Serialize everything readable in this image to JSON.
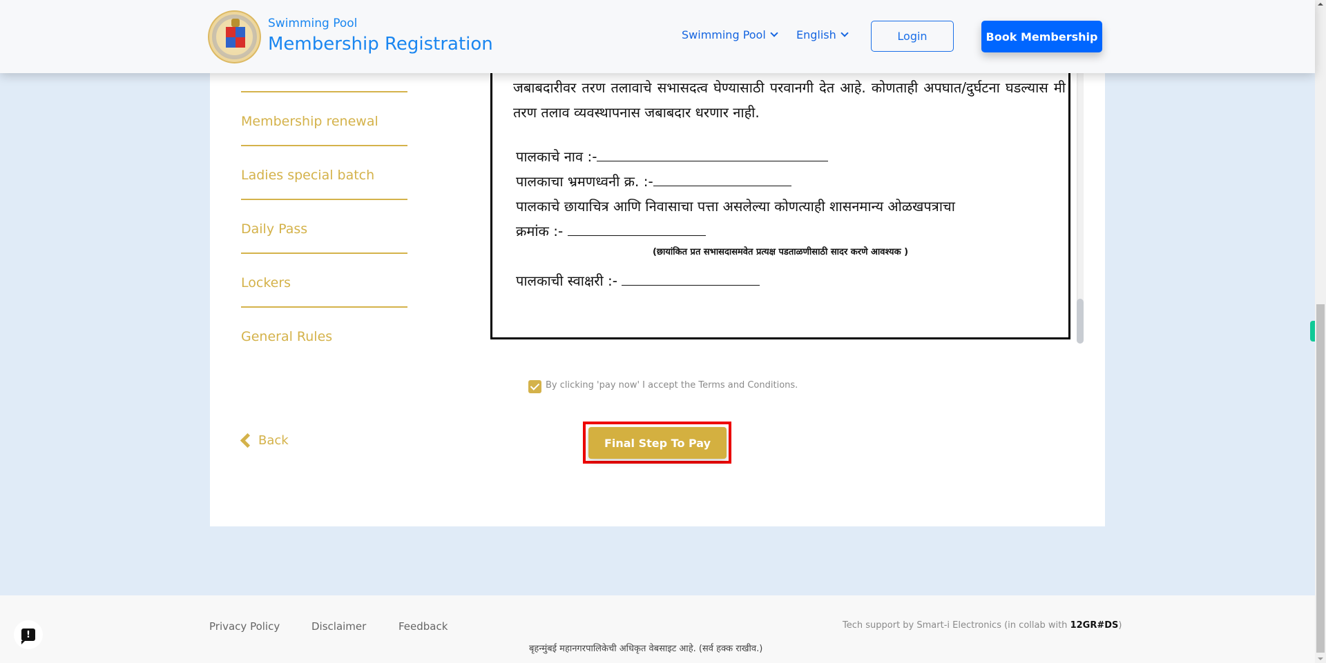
{
  "header": {
    "subtitle": "Swimming Pool",
    "title": "Membership Registration",
    "nav": [
      {
        "label": "Swimming Pool",
        "icon": "chevron-down-icon"
      },
      {
        "label": "English",
        "icon": "chevron-down-icon"
      }
    ],
    "login_label": "Login",
    "book_label": "Book Membership",
    "colors": {
      "primary": "#0066ff",
      "link": "#1a86f0"
    }
  },
  "sidebar": {
    "items": [
      {
        "label": "Membership renewal"
      },
      {
        "label": "Ladies special batch"
      },
      {
        "label": "Daily Pass"
      },
      {
        "label": "Lockers"
      },
      {
        "label": "General Rules"
      }
    ],
    "accent": "#d4b24a"
  },
  "document": {
    "paragraph": "जबाबदारीवर तरण तलावाचे सभासदत्व घेण्यासाठी परवानगी देत आहे. कोणताही अपघात/दुर्घटना घडल्यास मी तरण तलाव व्यवस्थापनास जबाबदार धरणार नाही.",
    "guardian_name_label": "पालकाचे नाव :-",
    "guardian_phone_label": "पालकाचा भ्रमणध्वनी क्र. :-",
    "guardian_id_label_line1": "पालकाचे छायाचित्र आणि निवासाचा पत्ता असलेल्या कोणत्याही शासनमान्य ओळखपत्राचा",
    "guardian_id_label_line2": "क्रमांक :-",
    "note": "(छायांकित प्रत सभासदासमवेत प्रत्यक्ष पडताळणीसाठी सादर करणे आवश्यक )",
    "guardian_signature_label": "पालकाची स्वाक्षरी :-"
  },
  "terms": {
    "checked": true,
    "label": "By clicking 'pay now' I accept the Terms and Conditions."
  },
  "actions": {
    "back_label": "Back",
    "pay_label": "Final Step To Pay"
  },
  "footer": {
    "links": [
      "Privacy Policy",
      "Disclaimer",
      "Feedback"
    ],
    "tech_support": "Tech support by Smart-i Electronics (in collab with ",
    "tech_brand": "12GR#DS",
    "tech_close": ")",
    "copyright": "बृहन्मुंबई महानगरपालिकेची अधिकृत वेबसाइट आहे. (सर्व हक्क राखीव.)",
    "feedback_fab_glyph": "!"
  }
}
